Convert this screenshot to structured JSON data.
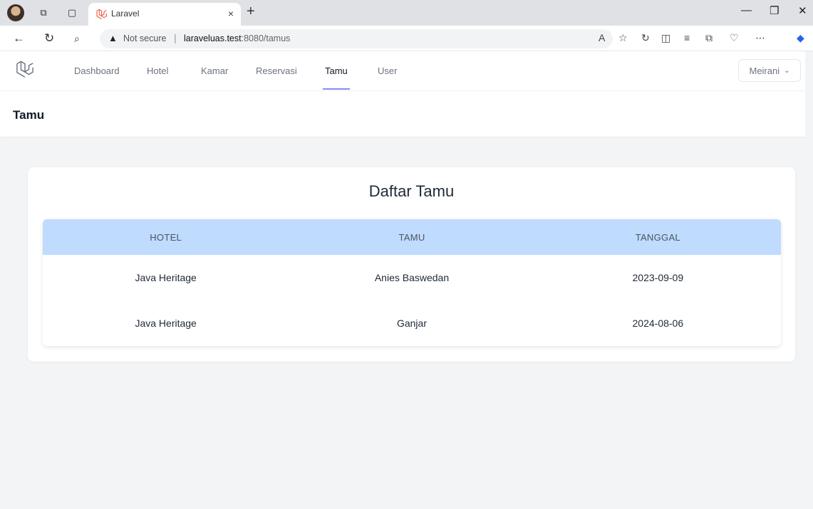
{
  "browser": {
    "tab_title": "Laravel",
    "tab_close": "×",
    "new_tab": "+",
    "not_secure": "Not secure",
    "url_host": "laraveluas.test",
    "url_rest": ":8080/tamus"
  },
  "nav": {
    "items": [
      "Dashboard",
      "Hotel",
      "Kamar",
      "Reservasi",
      "Tamu",
      "User"
    ],
    "active": "Tamu",
    "user": "Meirani"
  },
  "header": {
    "title": "Tamu"
  },
  "card": {
    "title": "Daftar Tamu",
    "columns": [
      "HOTEL",
      "TAMU",
      "TANGGAL"
    ],
    "rows": [
      [
        "Java Heritage",
        "Anies Baswedan",
        "2023-09-09"
      ],
      [
        "Java Heritage",
        "Ganjar",
        "2024-08-06"
      ]
    ]
  },
  "colors": {
    "header_bg": "#bfdbfe",
    "active_underline": "#818cf8"
  }
}
